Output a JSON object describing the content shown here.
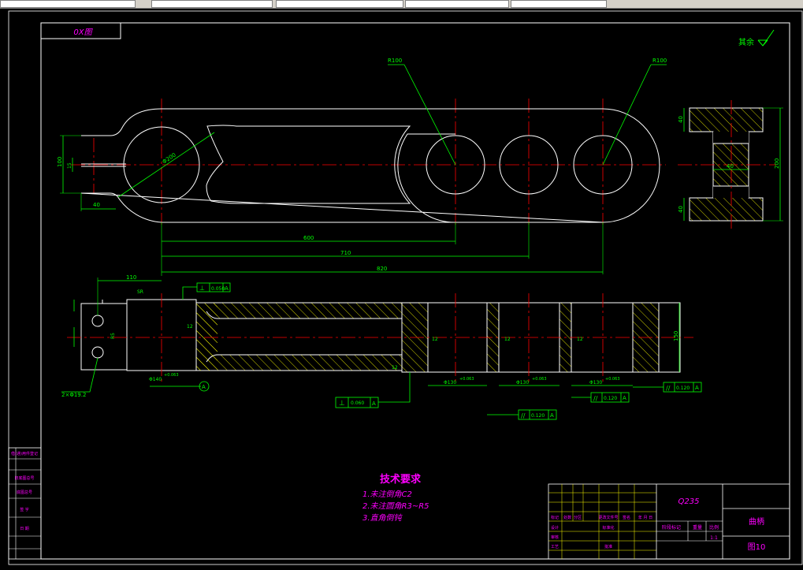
{
  "drawing": {
    "sheet_code": "0X图",
    "roughness_note": "其余",
    "dims_plan": {
      "r100_left": "R100",
      "r100_right": "R100",
      "d200": "Φ200",
      "h100": "100",
      "slot": "15",
      "w40": "40",
      "l600": "600",
      "l710": "710",
      "l820": "820"
    },
    "dims_side": {
      "t40_top": "40",
      "t40_mid": "40",
      "t40_bot": "40",
      "h200": "200"
    },
    "dims_section": {
      "l110": "110",
      "sr": "SR",
      "perp_top_tol": "0.050",
      "datum": "A",
      "r5": "R5",
      "d140": "Φ140",
      "d140_tol": "+0.063",
      "holes": "2×Φ19.2",
      "h150": "150",
      "b1_dia": "Φ130",
      "b1_tol": "+0.063",
      "b2_dia": "Φ130",
      "b2_tol": "+0.063",
      "b3_dia": "Φ130",
      "b3_tol": "+0.063",
      "ra": "12",
      "perp_bot_tol": "0.060",
      "par1_tol": "0.120",
      "par2_tol": "0.120",
      "par3_tol": "0.120",
      "small": "12"
    },
    "tech_title": "技术要求",
    "tech_notes": [
      "1.未注倒角C2",
      "2.未注圆角R3~R5",
      "3.直角倒钝"
    ]
  },
  "title_block": {
    "material": "Q235",
    "part_name": "曲柄",
    "drawing_no": "图10",
    "scale": "1:1",
    "h_mark": "标记",
    "h_count": "处数",
    "h_zone": "分区",
    "h_docno": "更改文件号",
    "h_sign": "签名",
    "h_date": "年 月 日",
    "r_design": "设计",
    "r_std": "标准化",
    "r_check": "审核",
    "r_proc": "工艺",
    "r_approve": "批准",
    "stage": "阶段标记",
    "weight": "重量",
    "scale_label": "比例"
  },
  "side_table": [
    "借(通)用件登记",
    "旧底图总号",
    "底图总号",
    "签 字",
    "日 期"
  ],
  "colors": {
    "bg": "#000000",
    "outline": "#ffffff",
    "dimension": "#00ff00",
    "center": "#ff0000",
    "text": "#ff00ff",
    "hatch": "#ffff00"
  }
}
